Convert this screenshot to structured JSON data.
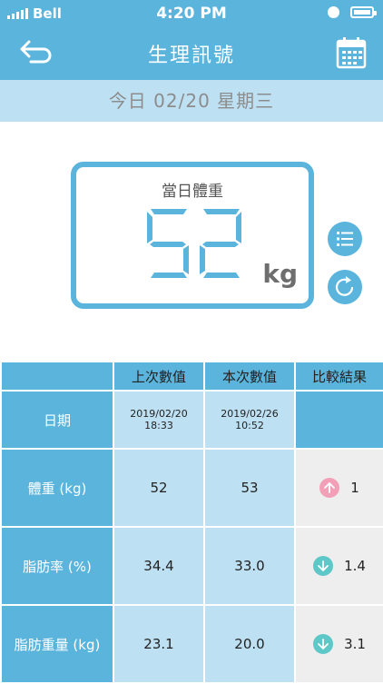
{
  "status_bar": {
    "carrier": "Bell",
    "time": "4:20 PM"
  },
  "nav": {
    "title": "生理訊號",
    "back_icon": "back-arrow-icon",
    "calendar_icon": "calendar-icon"
  },
  "date_bar": {
    "text": "今日 02/20 星期三"
  },
  "scale_display": {
    "label": "當日體重",
    "value": "52",
    "unit": "kg"
  },
  "side_buttons": {
    "list_icon": "list-icon",
    "refresh_icon": "refresh-icon"
  },
  "table": {
    "headers": [
      "",
      "上次數值",
      "本次數值",
      "比較結果"
    ],
    "date_row": {
      "label": "日期",
      "previous": [
        "2019/02/20",
        "18:33"
      ],
      "current": [
        "2019/02/26",
        "10:52"
      ],
      "result": ""
    },
    "rows": [
      {
        "label": "體重 (kg)",
        "previous": "52",
        "current": "53",
        "trend": "up",
        "diff": "1"
      },
      {
        "label": "脂肪率 (%)",
        "previous": "34.4",
        "current": "33.0",
        "trend": "down",
        "diff": "1.4"
      },
      {
        "label": "脂肪重量 (kg)",
        "previous": "23.1",
        "current": "20.0",
        "trend": "down",
        "diff": "3.1"
      }
    ]
  },
  "colors": {
    "primary": "#5ab4dc",
    "light": "#bde1f3",
    "up": "#f2a0b8",
    "down": "#5ec7c7",
    "result_bg": "#eeeeee"
  }
}
